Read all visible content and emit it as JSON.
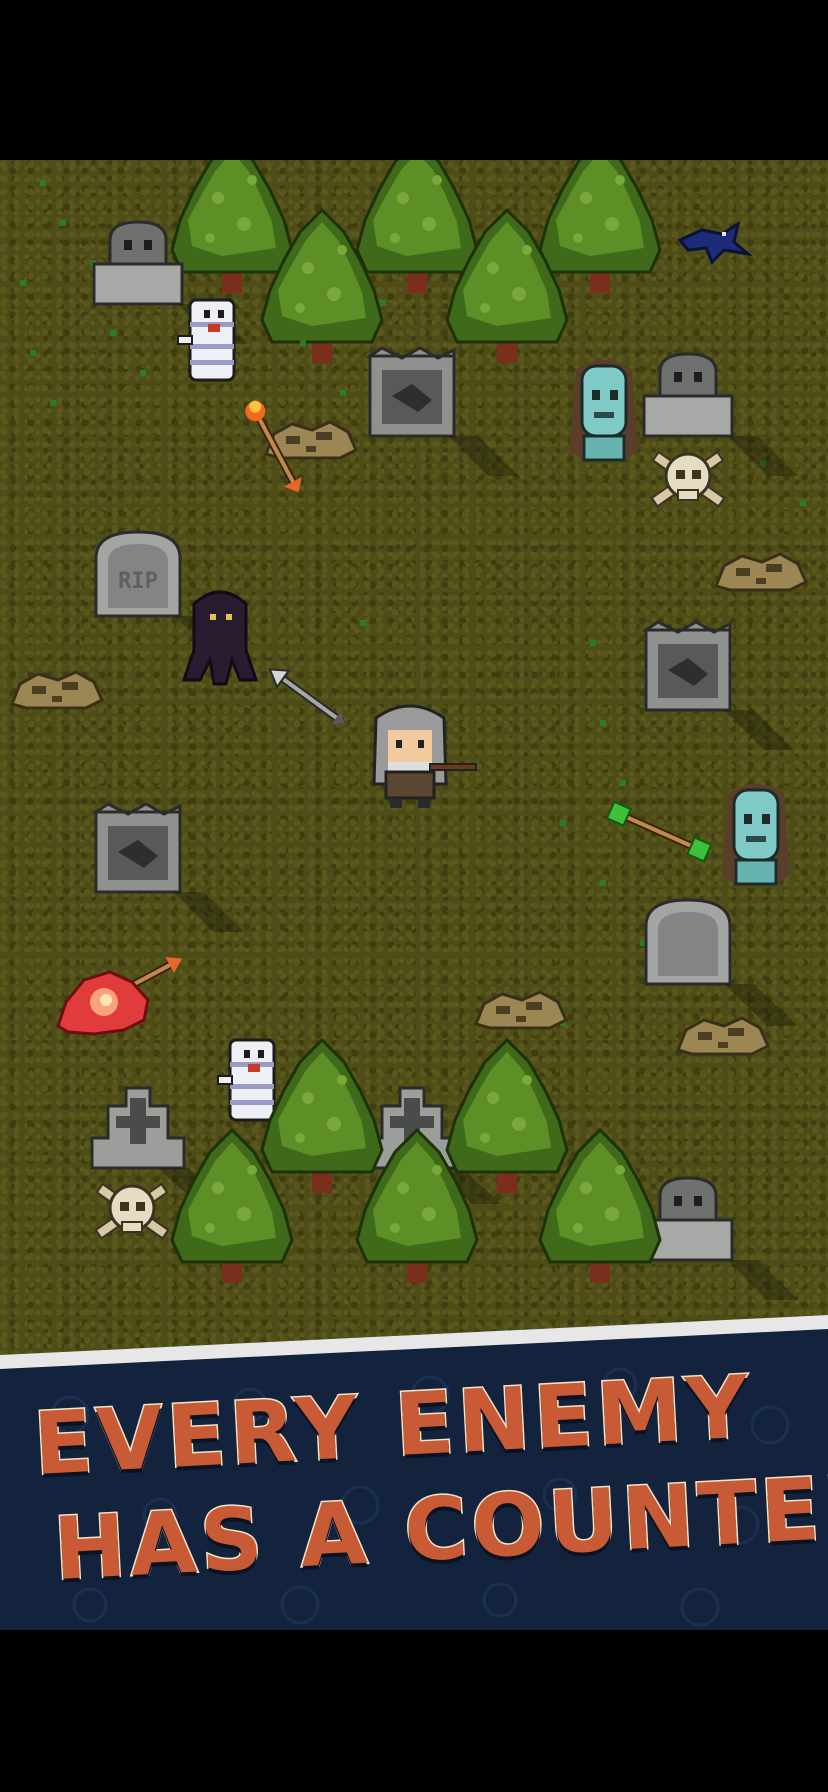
{
  "screen": {
    "type": "app-store-screenshot",
    "background": "#000000"
  },
  "scene": {
    "ground_color": "#4e4d17",
    "sprites": [
      {
        "kind": "player-archer",
        "icon": "hooded-archer"
      },
      {
        "kind": "enemy",
        "icon": "mummy-icon"
      },
      {
        "kind": "enemy",
        "icon": "zombie-icon"
      },
      {
        "kind": "enemy",
        "icon": "shadow-ghoul-icon"
      },
      {
        "kind": "enemy",
        "icon": "crow-icon"
      },
      {
        "kind": "projectile",
        "icon": "arrow-icon"
      },
      {
        "kind": "projectile",
        "icon": "fire-arrow-icon"
      },
      {
        "kind": "projectile",
        "icon": "poison-arrow-icon"
      },
      {
        "kind": "effect",
        "icon": "blood-splat-icon"
      },
      {
        "kind": "prop",
        "icon": "tombstone-icon"
      },
      {
        "kind": "prop",
        "icon": "skull-crossbones-icon"
      },
      {
        "kind": "prop",
        "icon": "pine-tree-icon"
      }
    ],
    "tombstone_text": "RIP"
  },
  "banner": {
    "line1": "EVERY ENEMY",
    "line2": "HAS A COUNTER",
    "text_color": "#c85a36",
    "outline_color": "#f4e6c7",
    "background_color": "#13233d"
  }
}
